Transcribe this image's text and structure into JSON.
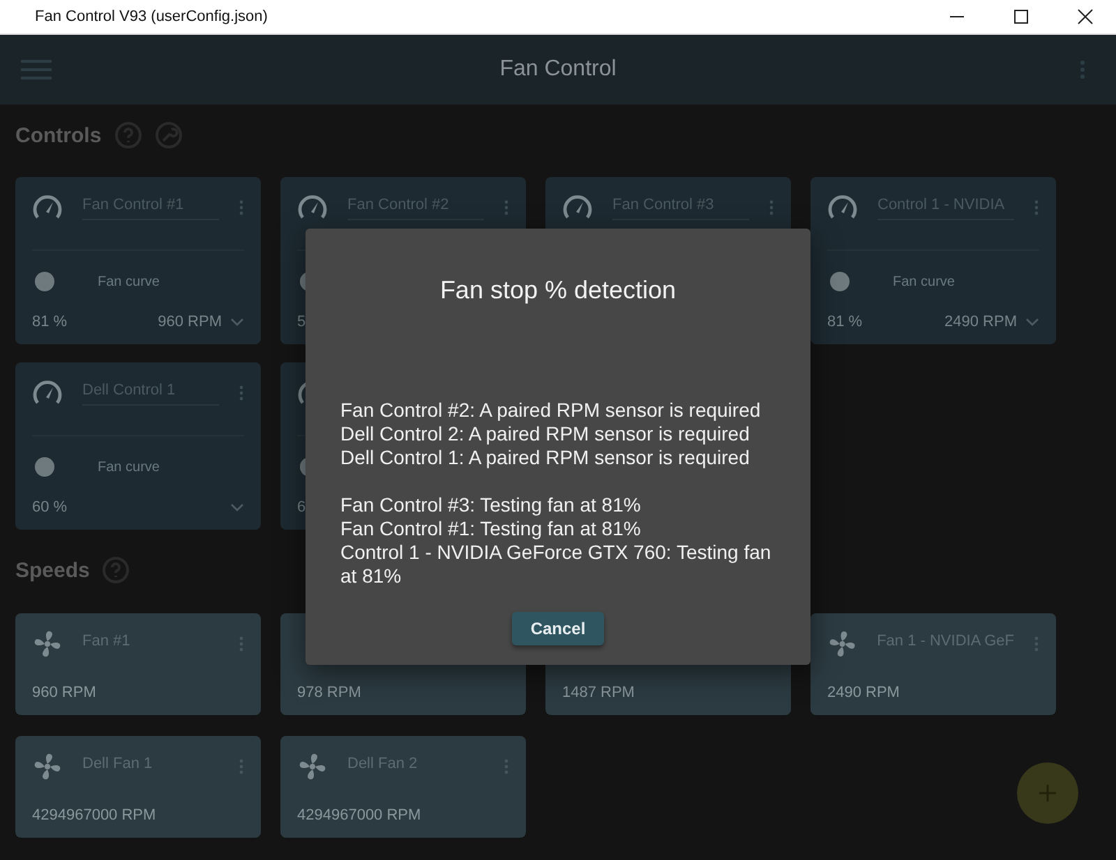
{
  "window": {
    "title": "Fan Control V93 (userConfig.json)"
  },
  "app_bar": {
    "title": "Fan Control"
  },
  "controls": {
    "heading": "Controls",
    "cards": [
      {
        "name": "Fan Control #1",
        "on": false,
        "mode": "Fan curve",
        "percent": "81 %",
        "rpm": "960 RPM"
      },
      {
        "name": "Fan Control #2",
        "on": false,
        "percent": "5"
      },
      {
        "name": "Fan Control #3"
      },
      {
        "name": "Control 1 - NVIDIA",
        "on": false,
        "mode": "Fan curve",
        "percent": "81 %",
        "rpm": "2490 RPM"
      },
      {
        "name": "Dell Control 1",
        "on": false,
        "mode": "Fan curve",
        "percent": "60 %"
      },
      {
        "on": false,
        "percent": "6"
      }
    ]
  },
  "speeds": {
    "heading": "Speeds",
    "cards": [
      {
        "name": "Fan #1",
        "rpm": "960 RPM"
      },
      {
        "rpm": "978 RPM"
      },
      {
        "rpm": "1487 RPM"
      },
      {
        "name": "Fan 1 - NVIDIA GeF",
        "rpm": "2490 RPM"
      },
      {
        "name": "Dell Fan 1",
        "rpm": "4294967000 RPM"
      },
      {
        "name": "Dell Fan 2",
        "rpm": "4294967000 RPM"
      }
    ]
  },
  "dialog": {
    "title": "Fan stop % detection",
    "paragraphs": [
      [
        "Fan Control #2: A paired RPM sensor is required",
        "Dell Control 2: A paired RPM sensor is required",
        "Dell Control 1: A paired RPM sensor is required"
      ],
      [
        "Fan Control #3: Testing fan at 81%",
        "Fan Control #1: Testing fan at 81%",
        "Control 1 - NVIDIA GeForce GTX 760: Testing fan at 81%"
      ]
    ],
    "button": "Cancel"
  }
}
